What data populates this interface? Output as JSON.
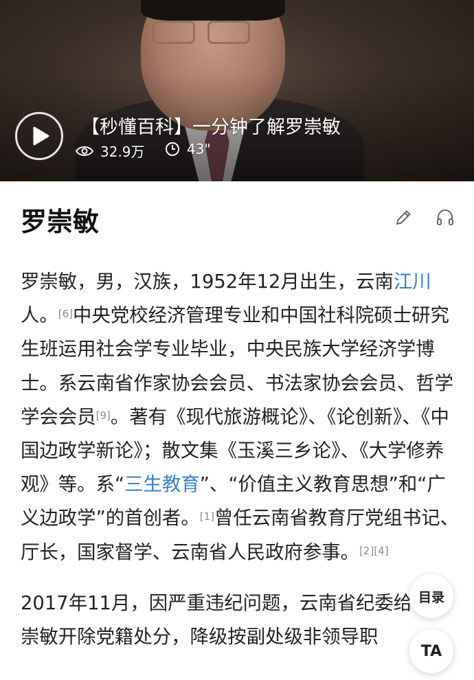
{
  "video": {
    "title": "【秒懂百科】一分钟了解罗崇敏",
    "views": "32.9万",
    "duration": "43\""
  },
  "page": {
    "title": "罗崇敏"
  },
  "article": {
    "p1": {
      "t1": "罗崇敏，男，汉族，1952年12月出生，云南",
      "link1": "江川",
      "t2": "人。",
      "ref1": "[6]",
      "t3": "中央党校经济管理专业和中国社科院硕士研究生班运用社会学专业毕业，中央民族大学经济学博士。系云南省作家协会会员、书法家协会会员、哲学学会会员",
      "ref2": "[9]",
      "t4": "。著有《现代旅游概论》、《论创新》、《中国边政学新论》；散文集《玉溪三乡论》、《大学修养观》等。系“",
      "link2": "三生教育",
      "t5": "”、“价值主义教育思想”和“广义边政学”的首创者。",
      "ref3": "[1]",
      "t6": "曾任云南省教育厅党组书记、厅长，国家督学、云南省人民政府参事。",
      "ref4": "[2][4]"
    },
    "p2": "2017年11月，因严重违纪问题，云南省纪委给予罗崇敏开除党籍处分，降级按副处级非领导职"
  },
  "floating": {
    "toc_label": "目录",
    "ta_label": "TA"
  }
}
